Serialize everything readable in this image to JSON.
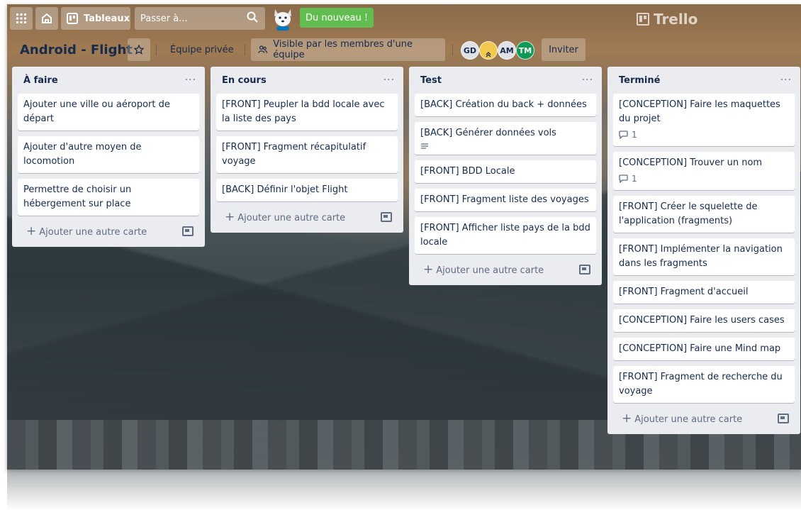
{
  "nav": {
    "boards_label": "Tableaux",
    "search_placeholder": "Passer à...",
    "new_badge": "Du nouveau !",
    "logo": "Trello"
  },
  "board": {
    "title": "Android - Flight",
    "team": "Équipe privée",
    "visibility": "Visible par les membres d'une équipe",
    "members": [
      {
        "initials": "GD",
        "color": "#dfe1e6"
      },
      {
        "initials": "",
        "color": "#f2c94c"
      },
      {
        "initials": "AM",
        "color": "#dfe1e6"
      },
      {
        "initials": "TM",
        "color": "#0e9a56"
      }
    ],
    "invite_label": "Inviter"
  },
  "add_card_label": "Ajouter une autre carte",
  "lists": [
    {
      "title": "À faire",
      "cards": [
        {
          "text": "Ajouter une ville ou aéroport de départ"
        },
        {
          "text": "Ajouter d'autre moyen de locomotion"
        },
        {
          "text": "Permettre de choisir un hébergement sur place"
        }
      ]
    },
    {
      "title": "En cours",
      "cards": [
        {
          "text": "[FRONT] Peupler la bdd locale avec la liste des pays"
        },
        {
          "text": "[FRONT] Fragment récapitulatif voyage"
        },
        {
          "text": "[BACK] Définir l'objet Flight"
        }
      ]
    },
    {
      "title": "Test",
      "cards": [
        {
          "text": "[BACK] Création du back + données"
        },
        {
          "text": "[BACK] Générer données vols"
        },
        {
          "text": "[FRONT] BDD Locale"
        },
        {
          "text": "[FRONT] Fragment liste des voyages"
        },
        {
          "text": "[FRONT] Afficher liste pays de la bdd locale"
        }
      ]
    },
    {
      "title": "Terminé",
      "cards": [
        {
          "text": "[CONCEPTION] Faire les maquettes du projet",
          "comments": "1"
        },
        {
          "text": "[CONCEPTION] Trouver un nom",
          "comments": "1"
        },
        {
          "text": "[FRONT] Créer le squelette de l'application (fragments)"
        },
        {
          "text": "[FRONT] Implémenter la navigation dans les fragments"
        },
        {
          "text": "[FRONT] Fragment d'accueil"
        },
        {
          "text": "[CONCEPTION] Faire les users cases"
        },
        {
          "text": "[CONCEPTION] Faire une Mind map"
        },
        {
          "text": "[FRONT] Fragment de recherche du voyage"
        }
      ]
    }
  ]
}
